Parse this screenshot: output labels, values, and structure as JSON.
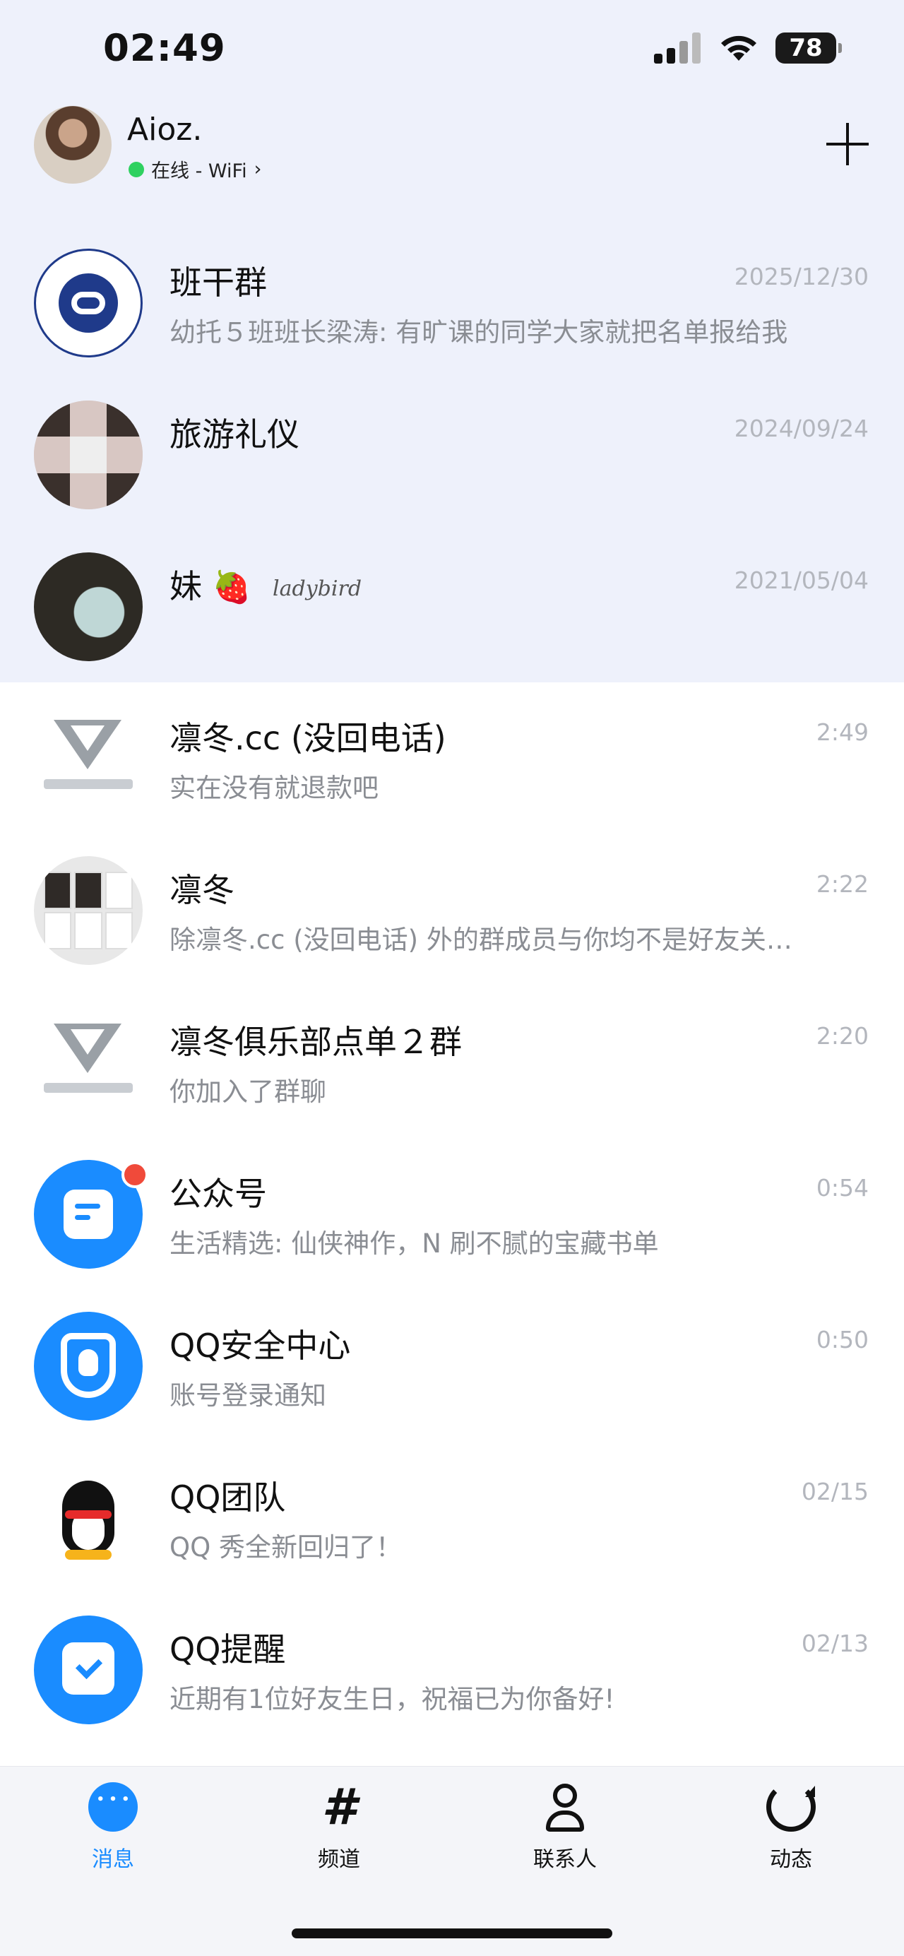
{
  "status_bar": {
    "time": "02:49",
    "battery": "78"
  },
  "header": {
    "name": "Aioz.",
    "status": "在线 - WiFi",
    "status_chevron": "›",
    "add_icon": "plus-icon"
  },
  "pinned": [
    {
      "title": "班干群",
      "time": "2025/12/30",
      "preview": "幼托５班班长梁涛: 有旷课的同学大家就把名单报给我",
      "avatar": "school-logo"
    },
    {
      "title": "旅游礼仪",
      "time": "2024/09/24",
      "preview": "",
      "avatar": "photo-grid"
    },
    {
      "title": "妹",
      "emoji": "🍓",
      "tag": "ladybird",
      "time": "2021/05/04",
      "preview": "",
      "avatar": "portrait"
    }
  ],
  "chats": [
    {
      "title": "凛冬.cc (没回电话)",
      "time": "2:49",
      "preview": "实在没有就退款吧",
      "avatar": "club-logo"
    },
    {
      "title": "凛冬",
      "time": "2:22",
      "preview": "除凛冬.cc (没回电话) 外的群成员与你均不是好友关…",
      "avatar": "club-collage"
    },
    {
      "title": "凛冬俱乐部点单２群",
      "time": "2:20",
      "preview": "你加入了群聊",
      "avatar": "club-logo"
    },
    {
      "title": "公众号",
      "time": "0:54",
      "preview": "生活精选: 仙侠神作，N 刷不腻的宝藏书单",
      "avatar": "official-account-icon",
      "unread_dot": true
    },
    {
      "title": "QQ安全中心",
      "time": "0:50",
      "preview": "账号登录通知",
      "avatar": "security-shield-icon"
    },
    {
      "title": "QQ团队",
      "time": "02/15",
      "preview": "QQ 秀全新回归了！",
      "avatar": "penguin-icon"
    },
    {
      "title": "QQ提醒",
      "time": "02/13",
      "preview": "近期有1位好友生日，祝福已为你备好!",
      "avatar": "calendar-check-icon"
    }
  ],
  "tabs": [
    {
      "label": "消息",
      "icon": "message-icon",
      "active": true
    },
    {
      "label": "频道",
      "icon": "hash-icon",
      "active": false
    },
    {
      "label": "联系人",
      "icon": "person-icon",
      "active": false
    },
    {
      "label": "动态",
      "icon": "refresh-icon",
      "active": false
    }
  ],
  "colors": {
    "accent": "#1a8cff",
    "pinned_bg": "#eef1fb",
    "online": "#2fd160",
    "badge": "#f04a3a"
  }
}
